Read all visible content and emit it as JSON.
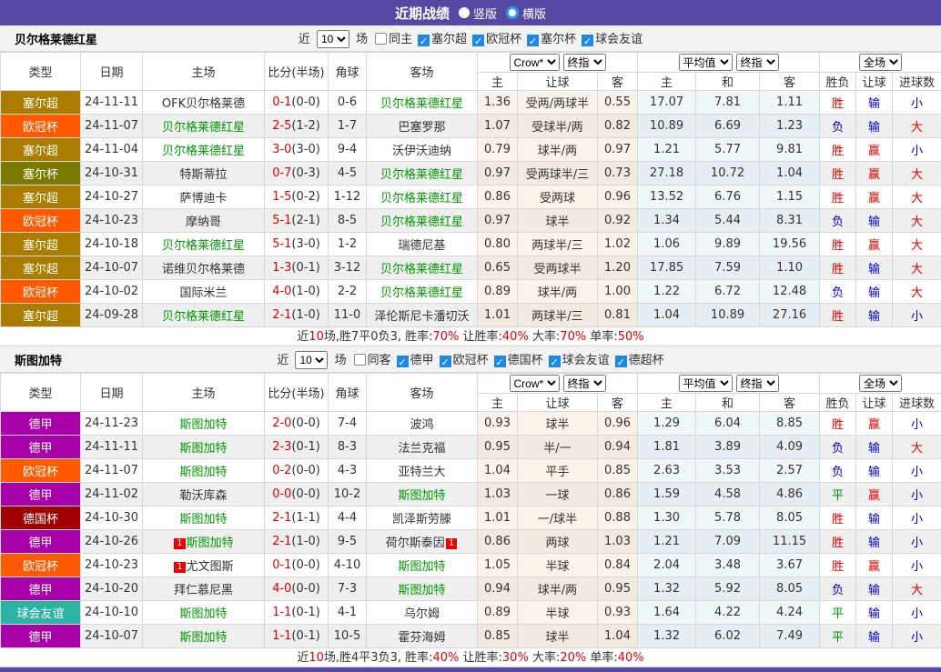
{
  "title_bar": {
    "title": "近期战绩",
    "radio_vertical": "竖版",
    "radio_horizontal": "横版",
    "bar_color": "#5549A2"
  },
  "shared": {
    "filter_prefix": "近",
    "filter_suffix": "场",
    "count_value": "10",
    "selects": {
      "odds_source": "Crow*",
      "odds_type": "终指",
      "avg": "平均值",
      "avg_type": "终指",
      "scope": "全场"
    },
    "headers_row1": [
      "类型",
      "日期",
      "主场",
      "比分(半场)",
      "角球",
      "客场"
    ],
    "headers_row2": [
      "主",
      "让球",
      "客",
      "主",
      "和",
      "客",
      "胜负",
      "让球",
      "进球数"
    ]
  },
  "league_colors": {
    "塞尔超": "#AA7D00",
    "欧冠杯": "#FF5A00",
    "塞尔杯": "#7A7A00",
    "德甲": "#A800A8",
    "德国杯": "#A00000",
    "球会友谊": "#2BB3A3"
  },
  "result_colors": {
    "胜": "#E60000",
    "负": "#0000CC",
    "平": "#008800",
    "赢": "#E60000",
    "输": "#0000CC",
    "大": "#E60000",
    "小": "#0000CC"
  },
  "score_color": "#EE0000",
  "team_color": "#009900",
  "tables": [
    {
      "team": "贝尔格莱德红星",
      "same_label": "同主",
      "same_checked": false,
      "leagues": [
        {
          "label": "塞尔超",
          "checked": true
        },
        {
          "label": "欧冠杯",
          "checked": true
        },
        {
          "label": "塞尔杯",
          "checked": true
        },
        {
          "label": "球会友谊",
          "checked": true
        }
      ],
      "rows": [
        {
          "league": "塞尔超",
          "date": "24-11-11",
          "home": {
            "name": "OFK贝尔格莱德",
            "team": false
          },
          "score": "0-1",
          "half": "(0-0)",
          "corners": "0-6",
          "away": {
            "name": "贝尔格莱德红星",
            "team": true
          },
          "odds": [
            "1.36",
            "受两/两球半",
            "0.55"
          ],
          "avg": [
            "17.07",
            "7.81",
            "1.11"
          ],
          "results": [
            "胜",
            "输",
            "小"
          ]
        },
        {
          "league": "欧冠杯",
          "date": "24-11-07",
          "home": {
            "name": "贝尔格莱德红星",
            "team": true
          },
          "score": "2-5",
          "half": "(1-2)",
          "corners": "1-7",
          "away": {
            "name": "巴塞罗那",
            "team": false
          },
          "odds": [
            "1.07",
            "受球半/两",
            "0.82"
          ],
          "avg": [
            "10.89",
            "6.69",
            "1.23"
          ],
          "results": [
            "负",
            "输",
            "大"
          ]
        },
        {
          "league": "塞尔超",
          "date": "24-11-04",
          "home": {
            "name": "贝尔格莱德红星",
            "team": true
          },
          "score": "3-0",
          "half": "(3-0)",
          "corners": "9-4",
          "away": {
            "name": "沃伊沃迪纳",
            "team": false
          },
          "odds": [
            "0.79",
            "球半/两",
            "0.97"
          ],
          "avg": [
            "1.21",
            "5.77",
            "9.81"
          ],
          "results": [
            "胜",
            "赢",
            "小"
          ]
        },
        {
          "league": "塞尔杯",
          "date": "24-10-31",
          "home": {
            "name": "特斯蒂拉",
            "team": false
          },
          "score": "0-7",
          "half": "(0-3)",
          "corners": "4-5",
          "away": {
            "name": "贝尔格莱德红星",
            "team": true
          },
          "odds": [
            "0.97",
            "受两球半/三",
            "0.73"
          ],
          "avg": [
            "27.18",
            "10.72",
            "1.04"
          ],
          "results": [
            "胜",
            "赢",
            "大"
          ]
        },
        {
          "league": "塞尔超",
          "date": "24-10-27",
          "home": {
            "name": "萨博迪卡",
            "team": false
          },
          "score": "1-5",
          "half": "(0-2)",
          "corners": "1-12",
          "away": {
            "name": "贝尔格莱德红星",
            "team": true
          },
          "odds": [
            "0.86",
            "受两球",
            "0.96"
          ],
          "avg": [
            "13.52",
            "6.76",
            "1.15"
          ],
          "results": [
            "胜",
            "赢",
            "大"
          ]
        },
        {
          "league": "欧冠杯",
          "date": "24-10-23",
          "home": {
            "name": "摩纳哥",
            "team": false
          },
          "score": "5-1",
          "half": "(2-1)",
          "corners": "8-5",
          "away": {
            "name": "贝尔格莱德红星",
            "team": true
          },
          "odds": [
            "0.97",
            "球半",
            "0.92"
          ],
          "avg": [
            "1.34",
            "5.44",
            "8.31"
          ],
          "results": [
            "负",
            "输",
            "大"
          ]
        },
        {
          "league": "塞尔超",
          "date": "24-10-18",
          "home": {
            "name": "贝尔格莱德红星",
            "team": true
          },
          "score": "5-1",
          "half": "(3-0)",
          "corners": "1-2",
          "away": {
            "name": "瑞德尼基",
            "team": false
          },
          "odds": [
            "0.80",
            "两球半/三",
            "1.02"
          ],
          "avg": [
            "1.06",
            "9.89",
            "19.56"
          ],
          "results": [
            "胜",
            "赢",
            "大"
          ]
        },
        {
          "league": "塞尔超",
          "date": "24-10-07",
          "home": {
            "name": "诺维贝尔格莱德",
            "team": false
          },
          "score": "1-3",
          "half": "(0-1)",
          "corners": "3-12",
          "away": {
            "name": "贝尔格莱德红星",
            "team": true
          },
          "odds": [
            "0.65",
            "受两球半",
            "1.20"
          ],
          "avg": [
            "17.85",
            "7.59",
            "1.10"
          ],
          "results": [
            "胜",
            "输",
            "大"
          ]
        },
        {
          "league": "欧冠杯",
          "date": "24-10-02",
          "home": {
            "name": "国际米兰",
            "team": false
          },
          "score": "4-0",
          "half": "(1-0)",
          "corners": "2-2",
          "away": {
            "name": "贝尔格莱德红星",
            "team": true
          },
          "odds": [
            "0.89",
            "球半/两",
            "1.00"
          ],
          "avg": [
            "1.22",
            "6.72",
            "12.48"
          ],
          "results": [
            "负",
            "输",
            "大"
          ]
        },
        {
          "league": "塞尔超",
          "date": "24-09-28",
          "home": {
            "name": "贝尔格莱德红星",
            "team": true
          },
          "score": "2-1",
          "half": "(1-0)",
          "corners": "11-0",
          "away": {
            "name": "泽伦斯尼卡潘切沃",
            "team": false
          },
          "odds": [
            "1.01",
            "两球半/三",
            "0.81"
          ],
          "avg": [
            "1.04",
            "10.89",
            "27.16"
          ],
          "results": [
            "胜",
            "输",
            "小"
          ]
        }
      ],
      "summary": [
        {
          "text": "近",
          "red": false
        },
        {
          "text": "10",
          "red": true
        },
        {
          "text": "场,胜7平0负3, 胜率:",
          "red": false
        },
        {
          "text": "70%",
          "red": true
        },
        {
          "text": " 让胜率:",
          "red": false
        },
        {
          "text": "40%",
          "red": true
        },
        {
          "text": " 大率:",
          "red": false
        },
        {
          "text": "70%",
          "red": true
        },
        {
          "text": " 单率:",
          "red": false
        },
        {
          "text": "50%",
          "red": true
        }
      ]
    },
    {
      "team": "斯图加特",
      "same_label": "同客",
      "same_checked": false,
      "leagues": [
        {
          "label": "德甲",
          "checked": true
        },
        {
          "label": "欧冠杯",
          "checked": true
        },
        {
          "label": "德国杯",
          "checked": true
        },
        {
          "label": "球会友谊",
          "checked": true
        },
        {
          "label": "德超杯",
          "checked": true
        }
      ],
      "rows": [
        {
          "league": "德甲",
          "date": "24-11-23",
          "home": {
            "name": "斯图加特",
            "team": true
          },
          "score": "2-0",
          "half": "(0-0)",
          "corners": "7-4",
          "away": {
            "name": "波鸿",
            "team": false
          },
          "odds": [
            "0.93",
            "球半",
            "0.96"
          ],
          "avg": [
            "1.29",
            "6.04",
            "8.85"
          ],
          "results": [
            "胜",
            "赢",
            "小"
          ]
        },
        {
          "league": "德甲",
          "date": "24-11-11",
          "home": {
            "name": "斯图加特",
            "team": true
          },
          "score": "2-3",
          "half": "(0-1)",
          "corners": "8-3",
          "away": {
            "name": "法兰克福",
            "team": false
          },
          "odds": [
            "0.95",
            "半/一",
            "0.94"
          ],
          "avg": [
            "1.81",
            "3.89",
            "4.09"
          ],
          "results": [
            "负",
            "输",
            "大"
          ]
        },
        {
          "league": "欧冠杯",
          "date": "24-11-07",
          "home": {
            "name": "斯图加特",
            "team": true
          },
          "score": "0-2",
          "half": "(0-0)",
          "corners": "4-3",
          "away": {
            "name": "亚特兰大",
            "team": false
          },
          "odds": [
            "1.04",
            "平手",
            "0.85"
          ],
          "avg": [
            "2.63",
            "3.53",
            "2.57"
          ],
          "results": [
            "负",
            "输",
            "小"
          ]
        },
        {
          "league": "德甲",
          "date": "24-11-02",
          "home": {
            "name": "勒沃库森",
            "team": false
          },
          "score": "0-0",
          "half": "(0-0)",
          "corners": "10-2",
          "away": {
            "name": "斯图加特",
            "team": true
          },
          "odds": [
            "1.03",
            "一球",
            "0.86"
          ],
          "avg": [
            "1.59",
            "4.58",
            "4.86"
          ],
          "results": [
            "平",
            "赢",
            "小"
          ]
        },
        {
          "league": "德国杯",
          "date": "24-10-30",
          "home": {
            "name": "斯图加特",
            "team": true
          },
          "score": "2-1",
          "half": "(1-1)",
          "corners": "4-4",
          "away": {
            "name": "凯泽斯劳滕",
            "team": false
          },
          "odds": [
            "1.01",
            "一/球半",
            "0.88"
          ],
          "avg": [
            "1.30",
            "5.78",
            "8.05"
          ],
          "results": [
            "胜",
            "输",
            "小"
          ]
        },
        {
          "league": "德甲",
          "date": "24-10-26",
          "home": {
            "name": "斯图加特",
            "team": true,
            "card_before": "1"
          },
          "score": "2-1",
          "half": "(1-0)",
          "corners": "9-5",
          "away": {
            "name": "荷尔斯泰因",
            "team": false,
            "card_after": "1"
          },
          "odds": [
            "0.86",
            "两球",
            "1.03"
          ],
          "avg": [
            "1.21",
            "7.09",
            "11.15"
          ],
          "results": [
            "胜",
            "输",
            "小"
          ]
        },
        {
          "league": "欧冠杯",
          "date": "24-10-23",
          "home": {
            "name": "尤文图斯",
            "team": false,
            "card_before": "1"
          },
          "score": "0-1",
          "half": "(0-0)",
          "corners": "4-10",
          "away": {
            "name": "斯图加特",
            "team": true
          },
          "odds": [
            "1.05",
            "半球",
            "0.84"
          ],
          "avg": [
            "2.04",
            "3.48",
            "3.67"
          ],
          "results": [
            "胜",
            "赢",
            "小"
          ]
        },
        {
          "league": "德甲",
          "date": "24-10-20",
          "home": {
            "name": "拜仁慕尼黑",
            "team": false
          },
          "score": "4-0",
          "half": "(0-0)",
          "corners": "7-3",
          "away": {
            "name": "斯图加特",
            "team": true
          },
          "odds": [
            "0.94",
            "球半/两",
            "0.95"
          ],
          "avg": [
            "1.32",
            "5.92",
            "8.05"
          ],
          "results": [
            "负",
            "输",
            "大"
          ]
        },
        {
          "league": "球会友谊",
          "date": "24-10-10",
          "home": {
            "name": "斯图加特",
            "team": true
          },
          "score": "1-1",
          "half": "(0-1)",
          "corners": "4-1",
          "away": {
            "name": "乌尔姆",
            "team": false
          },
          "odds": [
            "0.89",
            "半球",
            "0.93"
          ],
          "avg": [
            "1.64",
            "4.22",
            "4.24"
          ],
          "results": [
            "平",
            "输",
            "小"
          ]
        },
        {
          "league": "德甲",
          "date": "24-10-07",
          "home": {
            "name": "斯图加特",
            "team": true
          },
          "score": "1-1",
          "half": "(0-1)",
          "corners": "10-5",
          "away": {
            "name": "霍芬海姆",
            "team": false
          },
          "odds": [
            "0.85",
            "球半",
            "1.04"
          ],
          "avg": [
            "1.32",
            "6.02",
            "7.49"
          ],
          "results": [
            "平",
            "输",
            "小"
          ]
        }
      ],
      "summary": [
        {
          "text": "近",
          "red": false
        },
        {
          "text": "10",
          "red": true
        },
        {
          "text": "场,胜4平3负3, 胜率:",
          "red": false
        },
        {
          "text": "40%",
          "red": true
        },
        {
          "text": " 让胜率:",
          "red": false
        },
        {
          "text": "30%",
          "red": true
        },
        {
          "text": " 大率:",
          "red": false
        },
        {
          "text": "20%",
          "red": true
        },
        {
          "text": " 单率:",
          "red": false
        },
        {
          "text": "40%",
          "red": true
        }
      ]
    }
  ]
}
